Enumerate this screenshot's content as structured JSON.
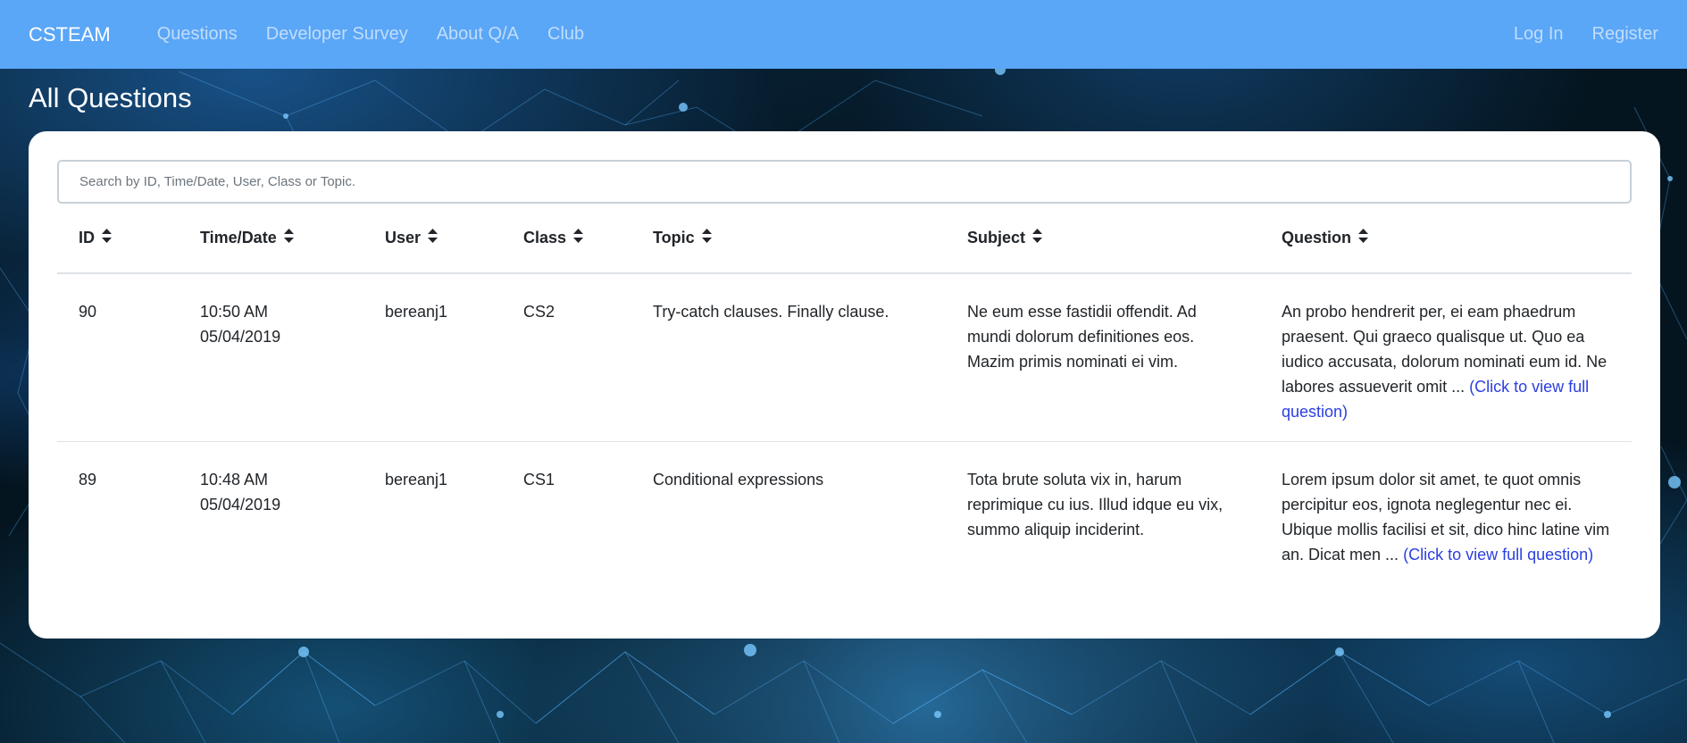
{
  "navbar": {
    "brand": "CSTEAM",
    "links": [
      {
        "label": "Questions"
      },
      {
        "label": "Developer Survey"
      },
      {
        "label": "About Q/A"
      },
      {
        "label": "Club"
      }
    ],
    "right_links": [
      {
        "label": "Log In"
      },
      {
        "label": "Register"
      }
    ],
    "background_color": "#5aa6f7"
  },
  "page": {
    "title": "All Questions"
  },
  "search": {
    "placeholder": "Search by ID, Time/Date, User, Class or Topic.",
    "value": ""
  },
  "table": {
    "columns": [
      "ID",
      "Time/Date",
      "User",
      "Class",
      "Topic",
      "Subject",
      "Question"
    ],
    "sort_icon": "sort-icon",
    "rows": [
      {
        "id": "90",
        "time": "10:50 AM",
        "date": "05/04/2019",
        "user": "bereanj1",
        "class": "CS2",
        "topic": "Try-catch clauses. Finally clause.",
        "subject": "Ne eum esse fastidii offendit. Ad mundi dolorum definitiones eos. Mazim primis nominati ei vim.",
        "question": "An probo hendrerit per, ei eam phaedrum praesent. Qui graeco qualisque ut. Quo ea iudico accusata, dolorum nominati eum id. Ne labores assueverit omit ...",
        "more_link": "(Click to view full question)"
      },
      {
        "id": "89",
        "time": "10:48 AM",
        "date": "05/04/2019",
        "user": "bereanj1",
        "class": "CS1",
        "topic": "Conditional expressions",
        "subject": "Tota brute soluta vix in, harum reprimique cu ius. Illud idque eu vix, summo aliquip inciderint.",
        "question": "Lorem ipsum dolor sit amet, te quot omnis percipitur eos, ignota neglegentur nec ei. Ubique mollis facilisi et sit, dico hinc latine vim an. Dicat men ...",
        "more_link": "(Click to view full question)"
      }
    ],
    "link_color": "#2a3fe0"
  }
}
